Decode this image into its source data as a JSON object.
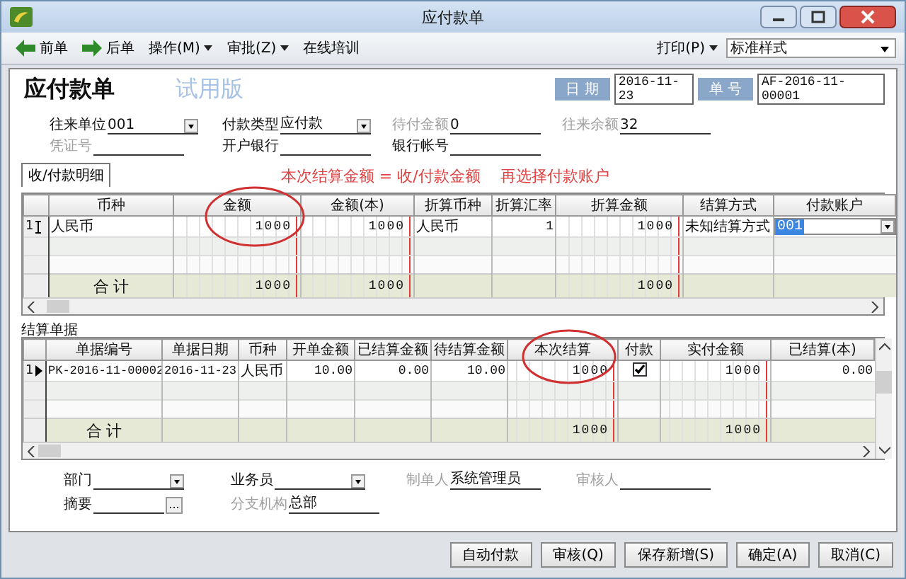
{
  "window": {
    "title": "应付款单"
  },
  "toolbar": {
    "items": [
      {
        "label": "前单",
        "kind": "back"
      },
      {
        "label": "后单",
        "kind": "forward"
      },
      {
        "label": "操作(M)",
        "kind": "menu"
      },
      {
        "label": "审批(Z)",
        "kind": "menu"
      },
      {
        "label": "在线培训",
        "kind": "plain"
      }
    ],
    "print": "打印(P)",
    "style_select": "标准样式"
  },
  "header": {
    "title": "应付款单",
    "trial": "试用版",
    "date_label": "日 期",
    "date": "2016-11-23",
    "number_label": "单 号",
    "number": "AF-2016-11-00001"
  },
  "top_fields": [
    {
      "label": "往来单位",
      "value": "001",
      "kind": "dropdown",
      "disabled": false
    },
    {
      "label": "付款类型",
      "value": "应付款",
      "kind": "dropdown",
      "disabled": false
    },
    {
      "label": "待付金额",
      "value": "0",
      "kind": "line",
      "disabled": true
    },
    {
      "label": "往来余额",
      "value": "32",
      "kind": "line",
      "disabled": true
    },
    {
      "label": "凭证号",
      "kind": "line",
      "disabled": true
    },
    {
      "label": "开户银行",
      "kind": "line",
      "disabled": false
    },
    {
      "label": "银行帐号",
      "kind": "line",
      "disabled": false
    }
  ],
  "detail_tab": {
    "label": "收/付款明细",
    "selected": true
  },
  "annotation": "本次结算金额 = 收/付款金额    再选择付款账户",
  "payment_grid": {
    "columns": [
      {
        "label": "币种",
        "kind": "text"
      },
      {
        "label": "金额",
        "kind": "amount",
        "total": "1000"
      },
      {
        "label": "金额(本)",
        "kind": "amount",
        "total": "1000"
      },
      {
        "label": "折算币种",
        "kind": "text"
      },
      {
        "label": "折算汇率",
        "kind": "number"
      },
      {
        "label": "折算金额",
        "kind": "amount",
        "total": "1000"
      },
      {
        "label": "结算方式",
        "kind": "text"
      },
      {
        "label": "付款账户",
        "kind": "account"
      }
    ],
    "rows": [
      {
        "number": "1",
        "editing": true,
        "cells": [
          "人民币",
          "1000",
          "1000",
          "人民币",
          "1",
          "1000",
          "未知结算方式",
          "001"
        ]
      }
    ],
    "total_label": "合 计"
  },
  "settle_label": "结算单据",
  "settle_grid": {
    "columns": [
      {
        "label": "单据编号",
        "kind": "code"
      },
      {
        "label": "单据日期",
        "kind": "code"
      },
      {
        "label": "币种",
        "kind": "text"
      },
      {
        "label": "开单金额",
        "kind": "number"
      },
      {
        "label": "已结算金额",
        "kind": "number"
      },
      {
        "label": "待结算金额",
        "kind": "number"
      },
      {
        "label": "本次结算",
        "kind": "amount",
        "total": "1000"
      },
      {
        "label": "付款",
        "kind": "check"
      },
      {
        "label": "实付金额",
        "kind": "amount",
        "total": "1000"
      },
      {
        "label": "已结算(本)",
        "kind": "number"
      }
    ],
    "rows": [
      {
        "number": "1",
        "current": true,
        "cells": [
          "PK-2016-11-00002",
          "2016-11-23",
          "人民币",
          "10.00",
          "0.00",
          "10.00",
          "1000",
          true,
          "1000",
          "0.00"
        ]
      }
    ],
    "total_label": "合 计"
  },
  "bottom_fields": [
    {
      "label": "部门",
      "kind": "dropdown",
      "disabled": false
    },
    {
      "label": "业务员",
      "kind": "dropdown",
      "disabled": false
    },
    {
      "label": "制单人",
      "value": "系统管理员",
      "kind": "line",
      "disabled": true
    },
    {
      "label": "审核人",
      "kind": "line",
      "disabled": true
    },
    {
      "label": "摘要",
      "kind": "ellipsis",
      "button": "...",
      "disabled": false
    },
    {
      "label": "分支机构",
      "value": "总部",
      "kind": "line",
      "disabled": true
    }
  ],
  "buttons": [
    "自动付款",
    "审核(Q)",
    "保存新增(S)",
    "确定(A)",
    "取消(C)"
  ]
}
